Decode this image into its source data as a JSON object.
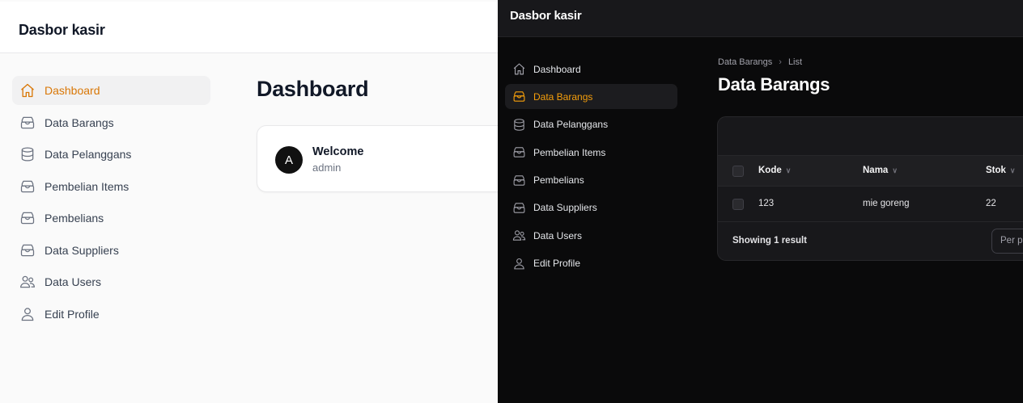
{
  "light": {
    "brand": "Dasbor kasir",
    "nav": [
      {
        "label": "Dashboard",
        "icon": "home-icon",
        "active": true
      },
      {
        "label": "Data Barangs",
        "icon": "inbox-icon",
        "active": false
      },
      {
        "label": "Data Pelanggans",
        "icon": "database-icon",
        "active": false
      },
      {
        "label": "Pembelian Items",
        "icon": "inbox-icon",
        "active": false
      },
      {
        "label": "Pembelians",
        "icon": "inbox-icon",
        "active": false
      },
      {
        "label": "Data Suppliers",
        "icon": "inbox-icon",
        "active": false
      },
      {
        "label": "Data Users",
        "icon": "users-icon",
        "active": false
      },
      {
        "label": "Edit Profile",
        "icon": "user-icon",
        "active": false
      }
    ],
    "page_title": "Dashboard",
    "card": {
      "avatar_letter": "A",
      "heading": "Welcome",
      "username": "admin"
    }
  },
  "dark": {
    "brand": "Dasbor kasir",
    "nav": [
      {
        "label": "Dashboard",
        "icon": "home-icon",
        "active": false
      },
      {
        "label": "Data Barangs",
        "icon": "inbox-icon",
        "active": true
      },
      {
        "label": "Data Pelanggans",
        "icon": "database-icon",
        "active": false
      },
      {
        "label": "Pembelian Items",
        "icon": "inbox-icon",
        "active": false
      },
      {
        "label": "Pembelians",
        "icon": "inbox-icon",
        "active": false
      },
      {
        "label": "Data Suppliers",
        "icon": "inbox-icon",
        "active": false
      },
      {
        "label": "Data Users",
        "icon": "users-icon",
        "active": false
      },
      {
        "label": "Edit Profile",
        "icon": "user-icon",
        "active": false
      }
    ],
    "breadcrumb": [
      "Data Barangs",
      "List"
    ],
    "page_title": "Data Barangs",
    "table": {
      "columns": [
        "Kode",
        "Nama",
        "Stok"
      ],
      "rows": [
        [
          "123",
          "mie goreng",
          "22"
        ]
      ],
      "footer": "Showing 1 result",
      "per_page_label": "Per page"
    }
  },
  "colors": {
    "accent_light": "#d97706",
    "accent_dark": "#f59e0b",
    "dark_bg": "#0a0a0b",
    "dark_panel": "#18181b"
  }
}
